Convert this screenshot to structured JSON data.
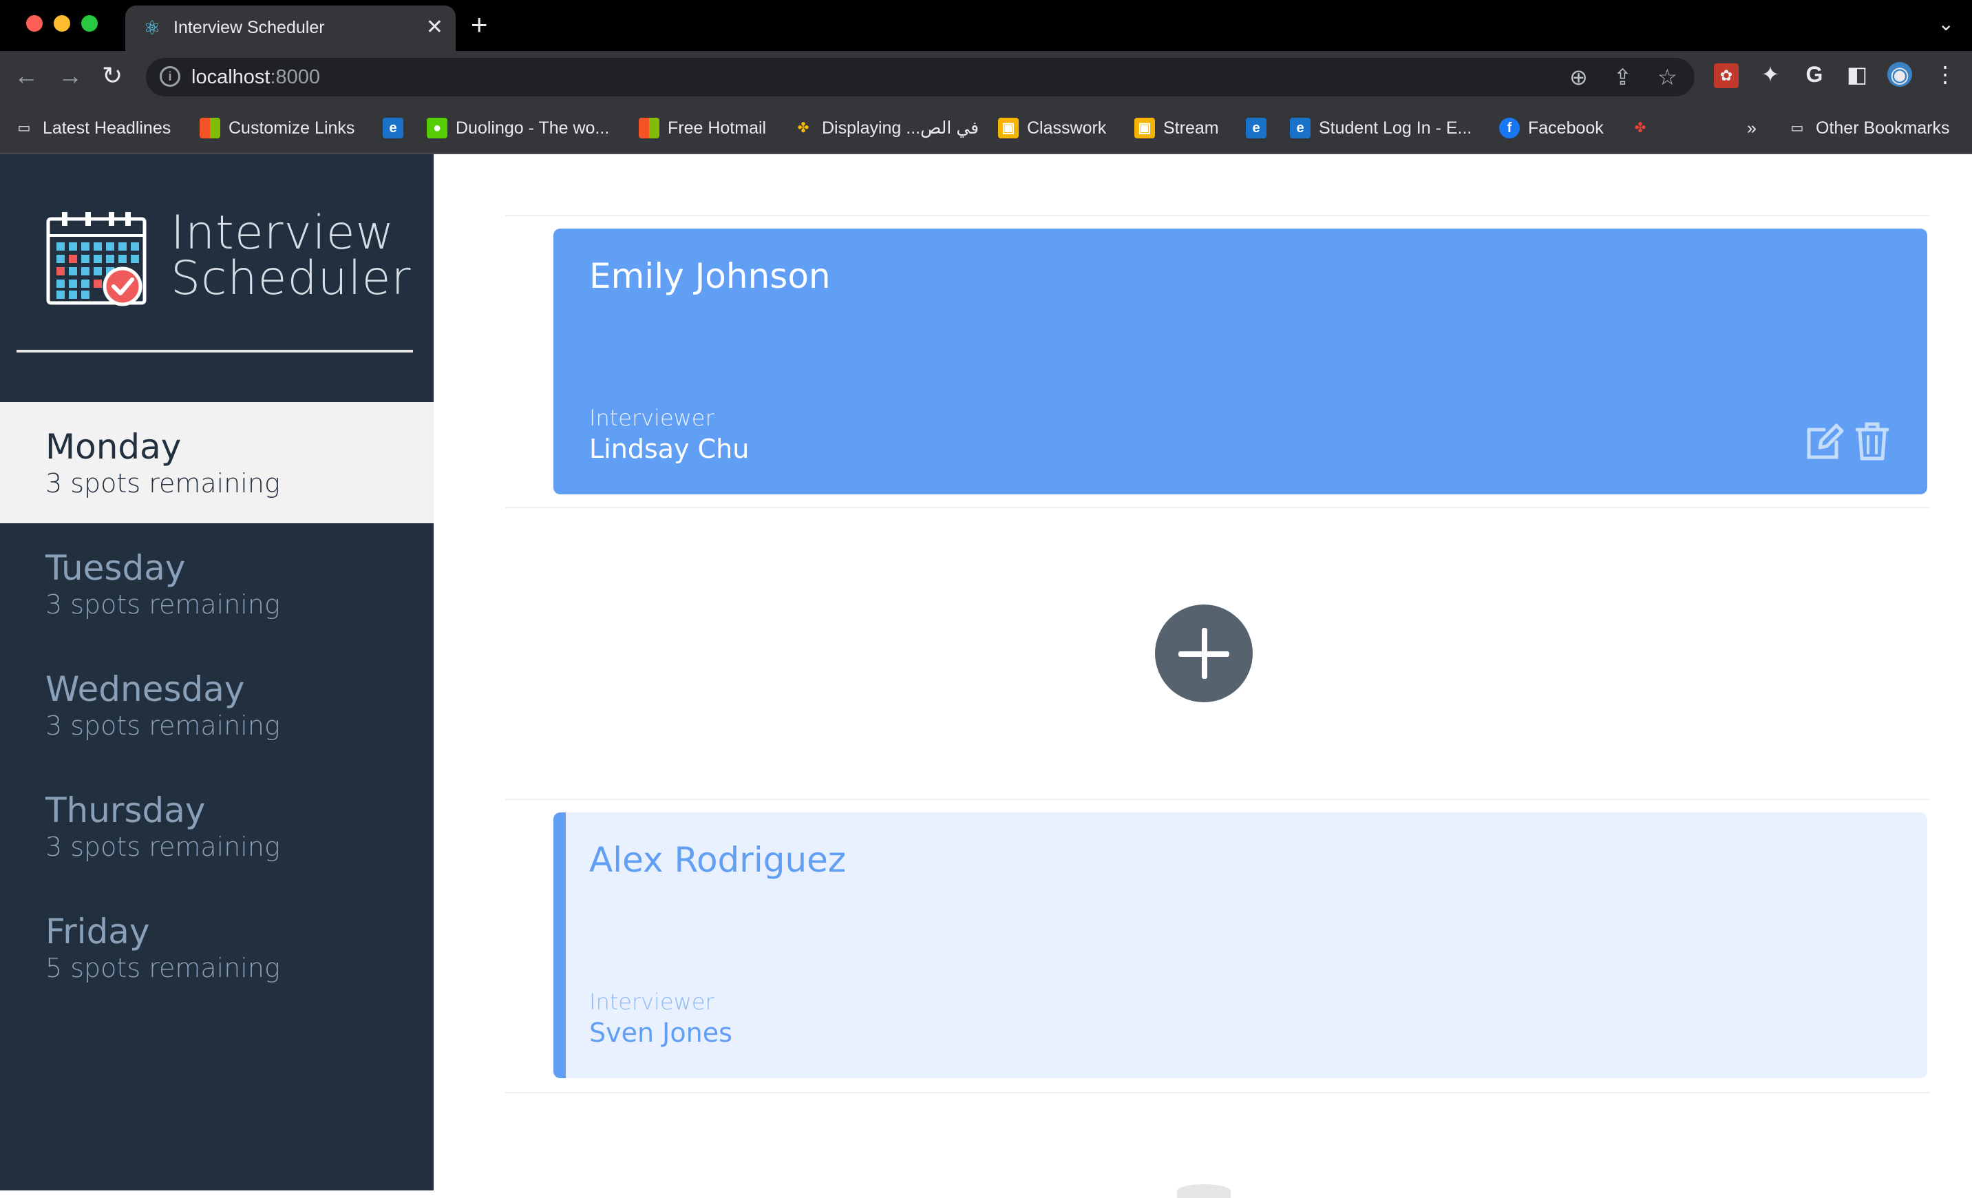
{
  "browser": {
    "tab_title": "Interview Scheduler",
    "url_host": "localhost",
    "url_port": ":8000",
    "bookmarks": [
      {
        "label": "Latest Headlines",
        "icon": "folder-icon"
      },
      {
        "label": "Customize Links",
        "icon": "windows-icon"
      },
      {
        "label": "",
        "icon": "el-icon"
      },
      {
        "label": "Duolingo - The wo...",
        "icon": "duolingo-icon"
      },
      {
        "label": "Free Hotmail",
        "icon": "windows-icon"
      },
      {
        "label": "Displaying ...في الص",
        "icon": "pinwheel-icon"
      },
      {
        "label": "Classwork",
        "icon": "classroom-icon"
      },
      {
        "label": "Stream",
        "icon": "classroom-icon"
      },
      {
        "label": "",
        "icon": "el-icon"
      },
      {
        "label": "Student Log In - E...",
        "icon": "el-icon"
      },
      {
        "label": "Facebook",
        "icon": "facebook-icon"
      },
      {
        "label": "",
        "icon": "pinwheel-icon"
      }
    ],
    "more_label": "»",
    "other_bookmarks": "Other Bookmarks"
  },
  "sidebar": {
    "brand_line1": "Interview",
    "brand_line2": "Scheduler",
    "days": [
      {
        "name": "Monday",
        "spots": "3 spots remaining",
        "selected": true
      },
      {
        "name": "Tuesday",
        "spots": "3 spots remaining",
        "selected": false
      },
      {
        "name": "Wednesday",
        "spots": "3 spots remaining",
        "selected": false
      },
      {
        "name": "Thursday",
        "spots": "3 spots remaining",
        "selected": false
      },
      {
        "name": "Friday",
        "spots": "5 spots remaining",
        "selected": false
      }
    ]
  },
  "appointments": [
    {
      "student": "Emily Johnson",
      "interviewer_label": "Interviewer",
      "interviewer": "Lindsay Chu",
      "state": "show-hover"
    },
    {
      "state": "empty"
    },
    {
      "student": "Alex Rodriguez",
      "interviewer_label": "Interviewer",
      "interviewer": "Sven Jones",
      "state": "show"
    }
  ],
  "colors": {
    "sidebar_bg": "#222f3e",
    "accent_blue": "#619ff5",
    "card_light": "#e8f1fd",
    "add_button": "#56636f"
  }
}
